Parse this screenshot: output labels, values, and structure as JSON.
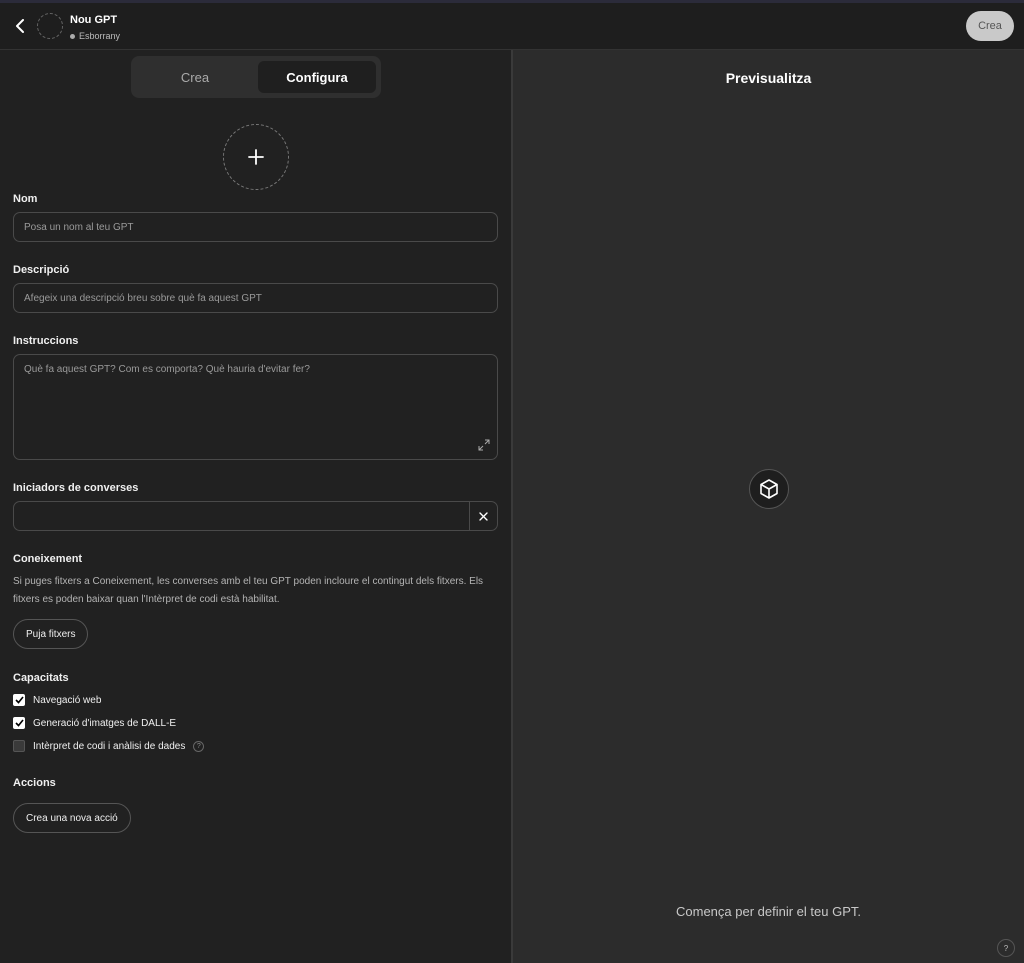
{
  "header": {
    "title": "Nou GPT",
    "status": "Esborrany",
    "create_button": "Crea"
  },
  "tabs": [
    {
      "label": "Crea",
      "active": false
    },
    {
      "label": "Configura",
      "active": true
    }
  ],
  "form": {
    "name": {
      "label": "Nom",
      "placeholder": "Posa un nom al teu GPT"
    },
    "description": {
      "label": "Descripció",
      "placeholder": "Afegeix una descripció breu sobre què fa aquest GPT"
    },
    "instructions": {
      "label": "Instruccions",
      "placeholder": "Què fa aquest GPT? Com es comporta? Què hauria d'evitar fer?"
    },
    "starters": {
      "label": "Iniciadors de converses",
      "value": ""
    },
    "knowledge": {
      "label": "Coneixement",
      "description": "Si puges fitxers a Coneixement, les converses amb el teu GPT poden incloure el contingut dels fitxers. Els fitxers es poden baixar quan l'Intèrpret de codi està habilitat.",
      "upload_button": "Puja fitxers"
    },
    "capabilities": {
      "label": "Capacitats",
      "items": [
        {
          "label": "Navegació web",
          "checked": true
        },
        {
          "label": "Generació d'imatges de DALL-E",
          "checked": true
        },
        {
          "label": "Intèrpret de codi i anàlisi de dades",
          "checked": false
        }
      ]
    },
    "actions": {
      "label": "Accions",
      "create_button": "Crea una nova acció"
    }
  },
  "preview": {
    "title": "Previsualitza",
    "hint": "Comença per definir el teu GPT.",
    "help": "?"
  },
  "colors": {
    "background": "#212121",
    "preview_bg": "#2c2c2c",
    "accent": "#ffffff"
  },
  "icons": [
    "chevron-left-icon",
    "plus-icon",
    "expand-icon",
    "close-icon",
    "check-icon",
    "question-icon",
    "cube-icon"
  ]
}
